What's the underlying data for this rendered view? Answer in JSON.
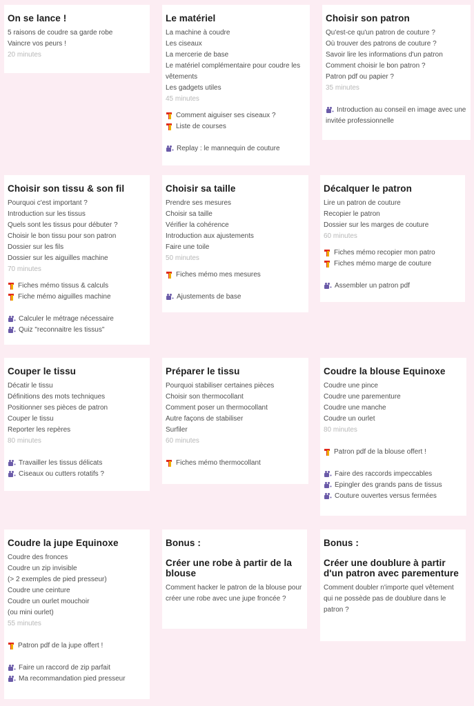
{
  "modules": [
    {
      "title": "On se lance !",
      "lessons": [
        "5 raisons de coudre sa garde robe",
        "Vaincre vos peurs !"
      ],
      "duration": "20 minutes"
    },
    {
      "title": "Le matériel",
      "lessons": [
        "La machine à coudre",
        "Les ciseaux",
        "La mercerie de base",
        "Le matériel complémentaire pour coudre les vêtements",
        "Les gadgets utiles"
      ],
      "duration": "45 minutes",
      "text_resources": [
        "Comment aiguiser ses ciseaux ?",
        "Liste de courses"
      ],
      "video_resources": [
        "Replay : le mannequin de couture"
      ]
    },
    {
      "title": "Choisir son patron",
      "lessons": [
        "Qu'est-ce qu'un patron de couture ?",
        "Où trouver des patrons de couture ?",
        "Savoir lire les informations d'un patron",
        "Comment choisir le bon patron ?",
        "Patron pdf ou papier ?"
      ],
      "duration": "35 minutes",
      "video_resources": [
        "Introduction au conseil en image avec une invitée professionnelle"
      ]
    },
    {
      "title": "Choisir son tissu & son fil",
      "lessons": [
        "Pourquoi c'est important ?",
        "Introduction sur les tissus",
        "Quels sont les tissus pour débuter ?",
        "Choisir le bon tissu pour son patron",
        "Dossier sur les fils",
        "Dossier sur les aiguilles machine"
      ],
      "duration": "70 minutes",
      "text_resources": [
        "Fiches mémo tissus & calculs",
        "Fiche mémo aiguilles machine"
      ],
      "video_resources": [
        "Calculer le métrage nécessaire",
        "Quiz \"reconnaitre les tissus\""
      ]
    },
    {
      "title": "Choisir sa taille",
      "lessons": [
        "Prendre ses mesures",
        "Choisir sa taille",
        "Vérifier la cohérence",
        "Introduction aux ajustements",
        "Faire une toile"
      ],
      "duration": "50 minutes",
      "text_resources": [
        "Fiches mémo mes mesures"
      ],
      "video_resources": [
        "Ajustements de base"
      ]
    },
    {
      "title": "Décalquer le patron",
      "lessons": [
        "Lire un patron de couture",
        "Recopier le patron",
        "Dossier sur les marges de couture"
      ],
      "duration": "60 minutes",
      "text_resources": [
        "Fiches mémo recopier mon patro",
        "Fiches mémo marge de couture"
      ],
      "video_resources": [
        "Assembler un patron pdf"
      ]
    },
    {
      "title": "Couper le tissu",
      "lessons": [
        "Décatir le tissu",
        "Définitions des mots techniques",
        "Positionner ses pièces de patron",
        "Couper le tissu",
        "Reporter les repères"
      ],
      "duration": "80 minutes",
      "video_resources": [
        "Travailler les tissus délicats",
        "Ciseaux ou cutters rotatifs ?"
      ]
    },
    {
      "title": "Préparer le tissu",
      "lessons": [
        "Pourquoi stabiliser certaines pièces",
        "Choisir son thermocollant",
        "Comment poser un thermocollant",
        "Autre façons de stabiliser",
        "Surfiler"
      ],
      "duration": "60 minutes",
      "text_resources": [
        "Fiches mémo thermocollant"
      ]
    },
    {
      "title": "Coudre la blouse Equinoxe",
      "lessons": [
        "Coudre une pince",
        "Coudre une parementure",
        "Coudre une manche",
        "Coudre un ourlet"
      ],
      "duration": "80 minutes",
      "text_resources": [
        "Patron pdf de la blouse offert !"
      ],
      "video_resources": [
        "Faire des raccords impeccables",
        "Epingler des grands pans de tissus",
        "Couture ouvertes versus fermées"
      ]
    },
    {
      "title": "Coudre la jupe Equinoxe",
      "lessons": [
        "Coudre des fronces",
        "Coudre un zip invisible",
        "(> 2 exemples de pied presseur)",
        "Coudre une ceinture",
        "Coudre un ourlet mouchoir",
        "(ou mini ourlet)"
      ],
      "duration": "55 minutes",
      "text_resources": [
        "Patron pdf de la jupe offert !"
      ],
      "video_resources": [
        "Faire un raccord de zip parfait",
        "Ma recommandation pied presseur"
      ]
    },
    {
      "label": "Bonus :",
      "title": "Créer une robe à partir de la blouse",
      "description": "Comment hacker le patron de la blouse pour créer une robe avec une jupe froncée ?"
    },
    {
      "label": "Bonus :",
      "title": "Créer une doublure à partir d'un patron avec parementure",
      "description": "Comment doubler n'importe quel vêtement qui ne possède pas de doublure dans le patron ?"
    }
  ],
  "icons": {
    "text_resource": "pdf-sheet-icon",
    "video_resource": "video-icon"
  },
  "colors": {
    "background": "#fcedf3",
    "card": "#ffffff",
    "title": "#1c1c1c",
    "text": "#4e4e4e",
    "duration": "#b7b7b7",
    "video_icon": "#6a5aa8",
    "sheet_icon_red": "#e02a1a",
    "sheet_icon_yellow": "#f0b000"
  }
}
